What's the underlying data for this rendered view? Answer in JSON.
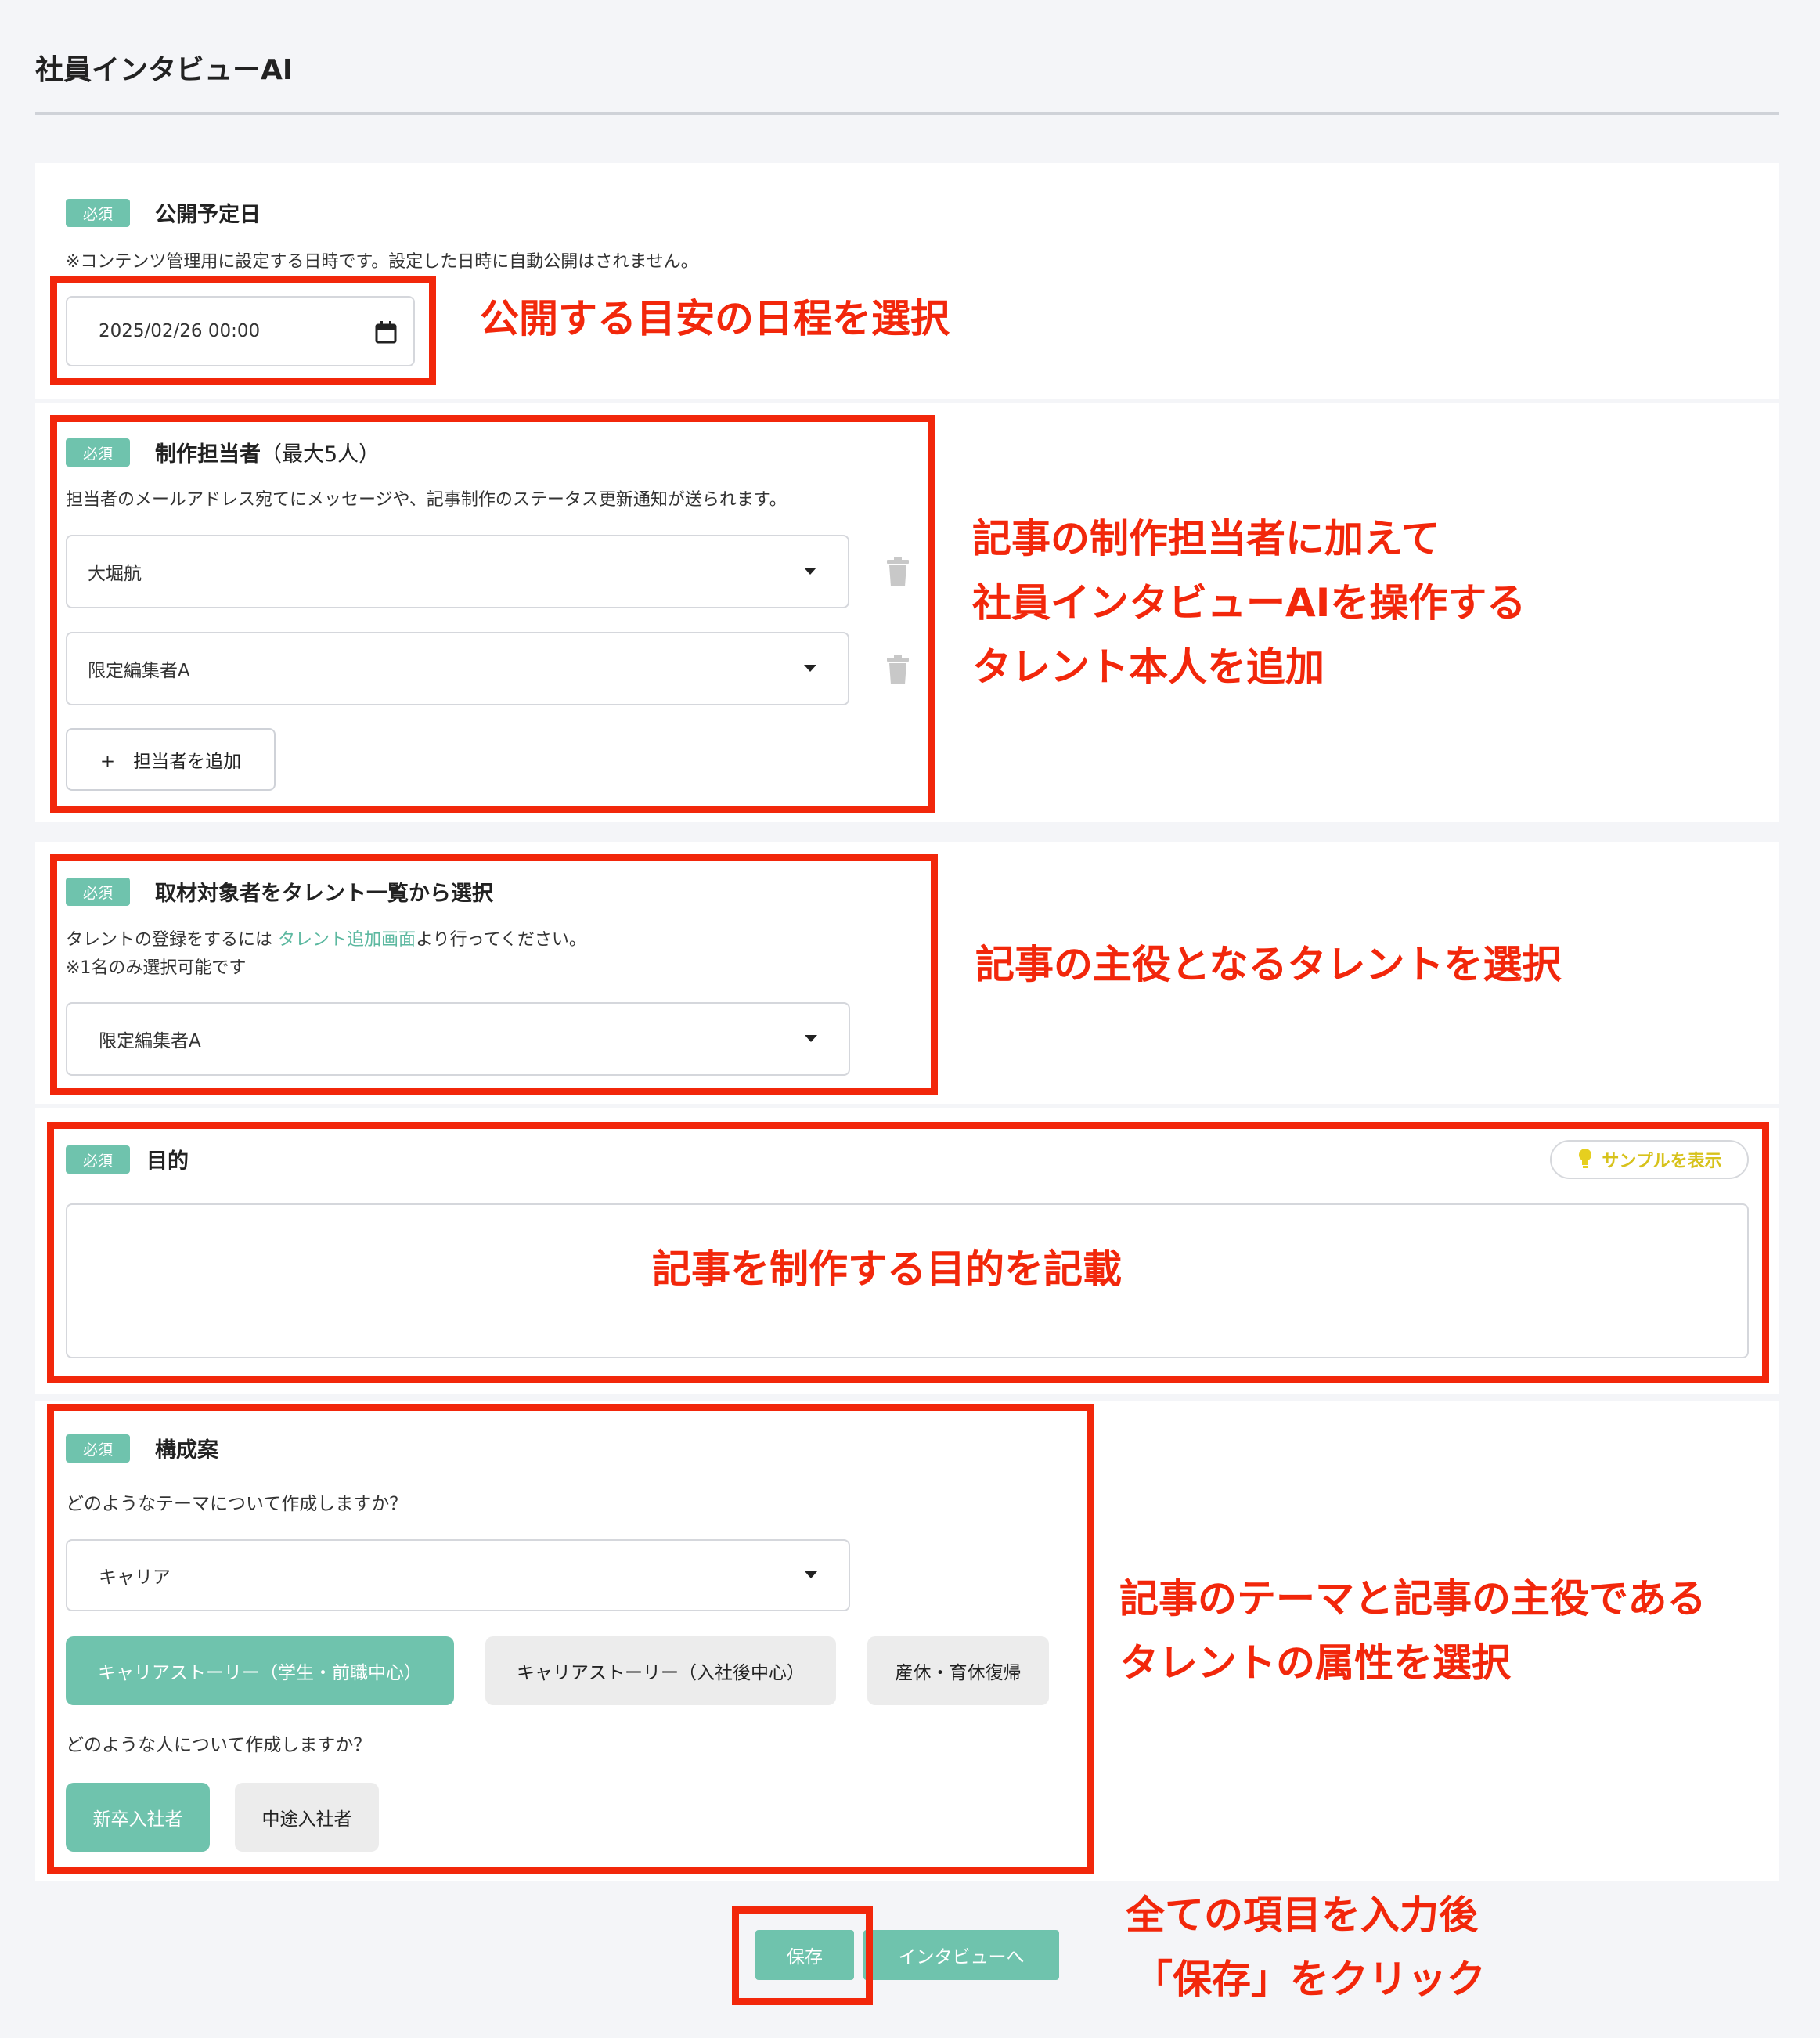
{
  "page": {
    "title": "社員インタビューAI"
  },
  "required_badge": "必須",
  "publish_date": {
    "label": "公開予定日",
    "hint": "※コンテンツ管理用に設定する日時です。設定した日時に自動公開はされません。",
    "value": "2025/02/26 00:00"
  },
  "creators": {
    "label": "制作担当者",
    "label_suffix": "（最大5人）",
    "hint": "担当者のメールアドレス宛てにメッセージや、記事制作のステータス更新通知が送られます。",
    "items": [
      "大堀航",
      "限定編集者A"
    ],
    "add_button": "+　担当者を追加"
  },
  "interviewee": {
    "label": "取材対象者をタレント一覧から選択",
    "hint_prefix": "タレントの登録をするには ",
    "hint_link": "タレント追加画面",
    "hint_suffix": "より行ってください。",
    "hint2": "※1名のみ選択可能です",
    "value": "限定編集者A"
  },
  "purpose": {
    "label": "目的",
    "sample_button": "サンプルを表示",
    "value": ""
  },
  "structure": {
    "label": "構成案",
    "theme_question": "どのようなテーマについて作成しますか？",
    "theme_value": "キャリア",
    "theme_chips": [
      {
        "label": "キャリアストーリー（学生・前職中心）",
        "selected": true
      },
      {
        "label": "キャリアストーリー（入社後中心）",
        "selected": false
      },
      {
        "label": "産休・育休復帰",
        "selected": false
      }
    ],
    "person_question": "どのような人について作成しますか？",
    "person_chips": [
      {
        "label": "新卒入社者",
        "selected": true
      },
      {
        "label": "中途入社者",
        "selected": false
      }
    ]
  },
  "actions": {
    "save": "保存",
    "to_interview": "インタビューへ"
  },
  "annotations": {
    "date": "公開する目安の日程を選択",
    "creators_line1": "記事の制作担当者に加えて",
    "creators_line2": "社員インタビューAIを操作する",
    "creators_line3": "タレント本人を追加",
    "interviewee": "記事の主役となるタレントを選択",
    "purpose": "記事を制作する目的を記載",
    "structure_line1": "記事のテーマと記事の主役である",
    "structure_line2": "タレントの属性を選択",
    "save_line1": "全ての項目を入力後",
    "save_line2": "「保存」をクリック"
  },
  "colors": {
    "accent": "#6fc3ad",
    "annotation_red": "#f2270b",
    "sample_yellow": "#d7c21b",
    "background": "#f4f5f8"
  }
}
